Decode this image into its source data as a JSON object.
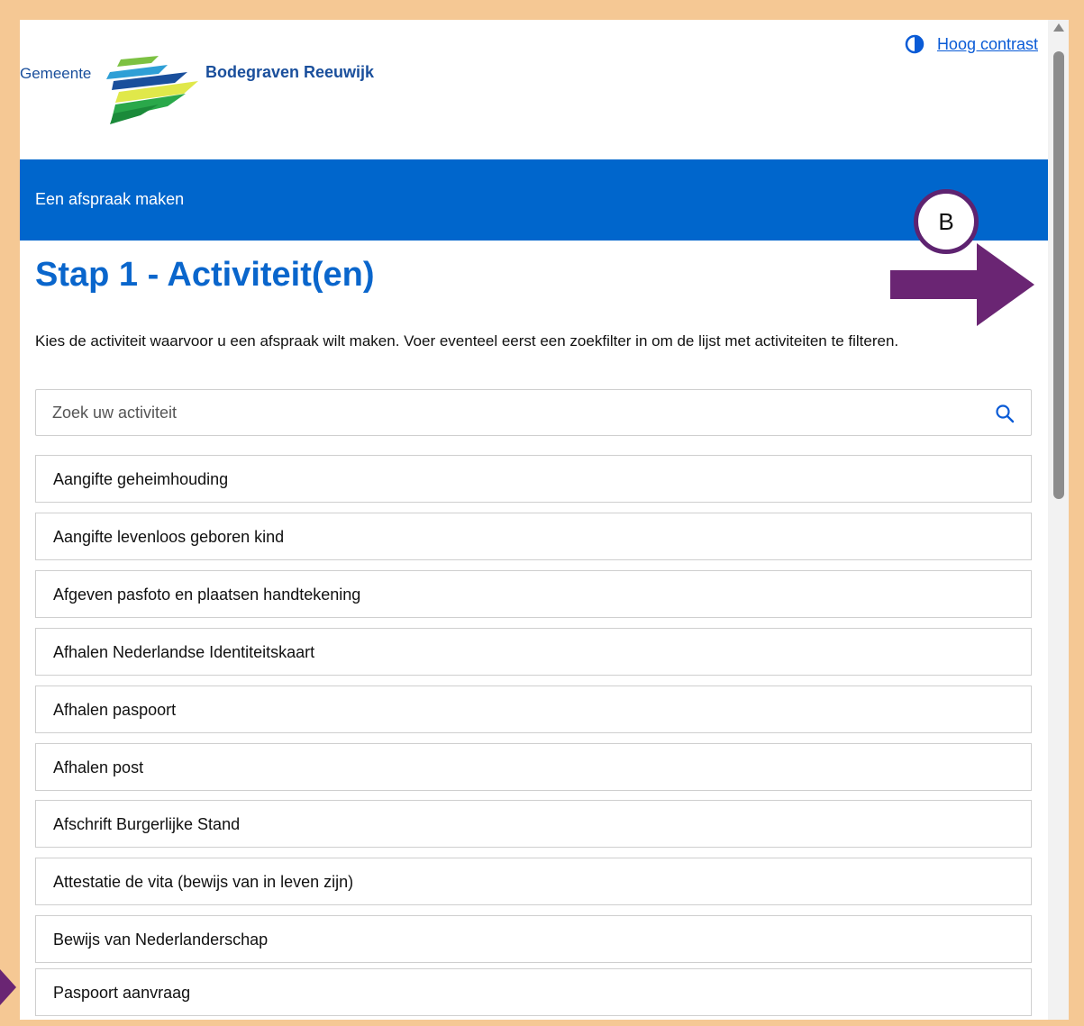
{
  "header": {
    "logo_prefix": "Gemeente",
    "logo_name": "Bodegraven Reeuwijk",
    "contrast_icon": "half-circle-contrast-icon",
    "contrast_label": "Hoog contrast"
  },
  "banner": {
    "text": "Een afspraak maken"
  },
  "main": {
    "title": "Stap 1 - Activiteit(en)",
    "intro": "Kies de activiteit waarvoor u een afspraak wilt maken. Voer eventeel eerst een zoekfilter in om de lijst met activiteiten te filteren.",
    "search": {
      "placeholder": "Zoek uw activiteit",
      "value": ""
    },
    "activities": [
      "Aangifte geheimhouding",
      "Aangifte levenloos geboren kind",
      "Afgeven pasfoto en plaatsen handtekening",
      "Afhalen Nederlandse Identiteitskaart",
      "Afhalen paspoort",
      "Afhalen post",
      "Afschrift Burgerlijke Stand",
      "Attestatie de vita (bewijs van in leven zijn)",
      "Bewijs van Nederlanderschap",
      "Paspoort aanvraag"
    ]
  },
  "annotation": {
    "badge_label": "B"
  },
  "colors": {
    "frame": "#f5c894",
    "banner": "#0066cc",
    "title": "#0a66cc",
    "annotation": "#6a2573"
  }
}
